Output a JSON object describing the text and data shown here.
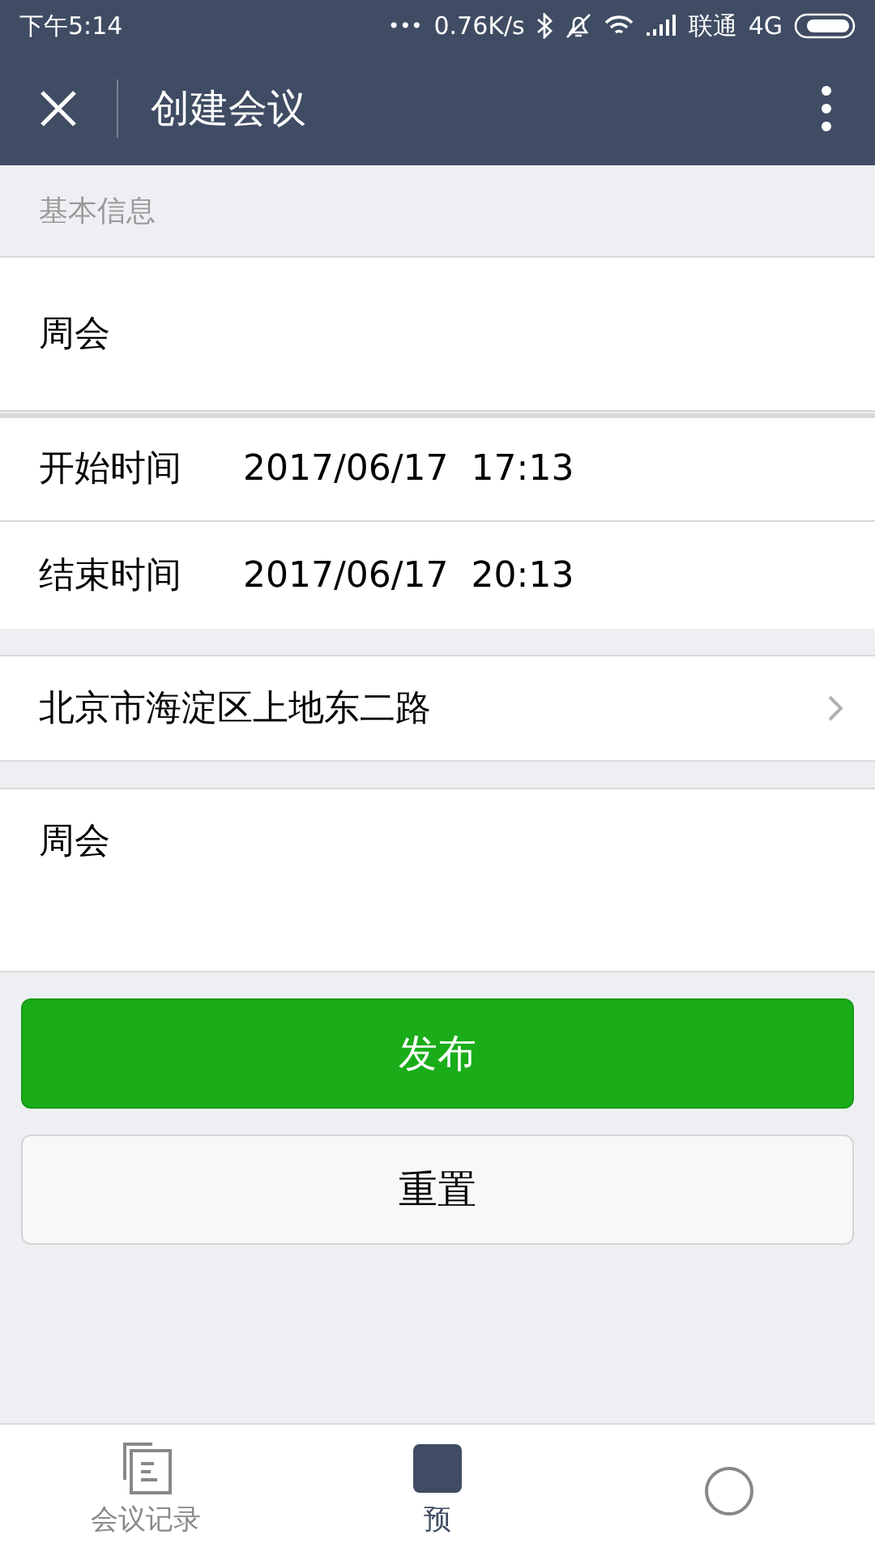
{
  "status_bar": {
    "time": "下午5:14",
    "dots": "•••",
    "speed": "0.76K/s",
    "carrier": "联通",
    "network": "4G"
  },
  "nav": {
    "title": "创建会议"
  },
  "section_label": "基本信息",
  "title_field": {
    "value": "周会"
  },
  "times": [
    {
      "label": "开始时间",
      "value": "2017/06/17  17:13"
    },
    {
      "label": "结束时间",
      "value": "2017/06/17  20:13"
    }
  ],
  "location": {
    "value": "北京市海淀区上地东二路"
  },
  "description": {
    "value": "周会"
  },
  "buttons": [
    {
      "label": "发布",
      "kind": "primary"
    },
    {
      "label": "重置",
      "kind": "default"
    }
  ],
  "tabs": [
    {
      "label": "会议记录",
      "selected": false
    },
    {
      "label": "预",
      "selected": true
    },
    {
      "selected": false
    }
  ]
}
